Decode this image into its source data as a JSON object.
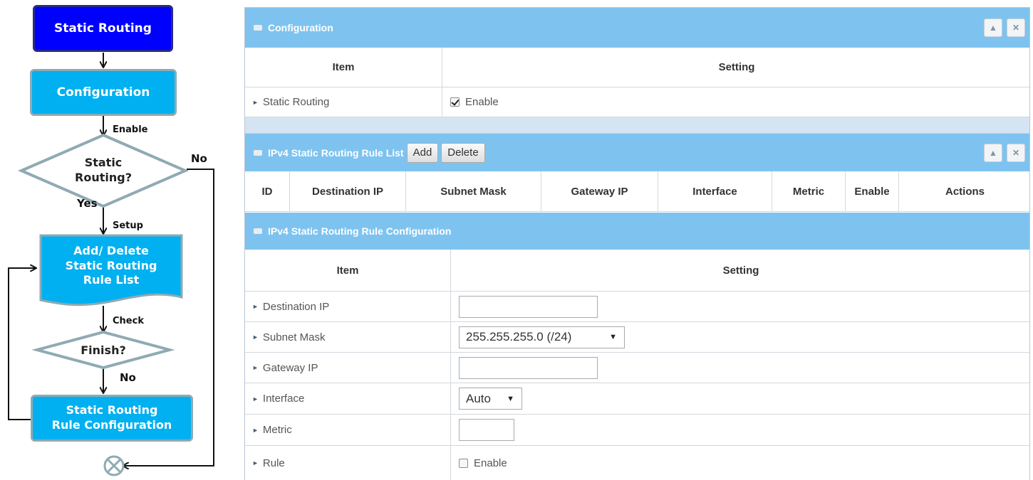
{
  "flowchart": {
    "nodes": {
      "start": "Static Routing",
      "configuration": "Configuration",
      "decision_line1": "Static",
      "decision_line2": "Routing?",
      "rule_list_line1": "Add/ Delete",
      "rule_list_line2": "Static Routing",
      "rule_list_line3": "Rule List",
      "finish": "Finish?",
      "rule_config_line1": "Static Routing",
      "rule_config_line2": "Rule Configuration"
    },
    "edge_labels": {
      "enable": "Enable",
      "no_right": "No",
      "yes": "Yes",
      "setup": "Setup",
      "check": "Check",
      "no_finish": "No"
    },
    "colors": {
      "start_fill": "#0000ff",
      "process_fill": "#00b0f0",
      "diamond_stroke": "#8faab3"
    },
    "end_symbol": "circle-x-icon"
  },
  "configuration_panel": {
    "title": "Configuration",
    "header_item": "Item",
    "header_setting": "Setting",
    "rows": [
      {
        "label": "Static Routing",
        "checkbox_checked": true,
        "checkbox_label": "Enable"
      }
    ]
  },
  "rule_list_panel": {
    "title": "IPv4 Static Routing Rule List",
    "add_label": "Add",
    "delete_label": "Delete",
    "columns": [
      "ID",
      "Destination IP",
      "Subnet Mask",
      "Gateway IP",
      "Interface",
      "Metric",
      "Enable",
      "Actions"
    ]
  },
  "rule_config_panel": {
    "title": "IPv4 Static Routing Rule Configuration",
    "header_item": "Item",
    "header_setting": "Setting",
    "destination_ip": {
      "label": "Destination IP",
      "value": ""
    },
    "subnet_mask": {
      "label": "Subnet Mask",
      "value": "255.255.255.0 (/24)"
    },
    "gateway_ip": {
      "label": "Gateway IP",
      "value": ""
    },
    "interface": {
      "label": "Interface",
      "value": "Auto"
    },
    "metric": {
      "label": "Metric",
      "value": ""
    },
    "rule": {
      "label": "Rule",
      "checkbox_checked": false,
      "checkbox_label": "Enable"
    }
  },
  "colors": {
    "panel_header": "#7ec3ef",
    "separator_band": "#d5e4f3"
  }
}
